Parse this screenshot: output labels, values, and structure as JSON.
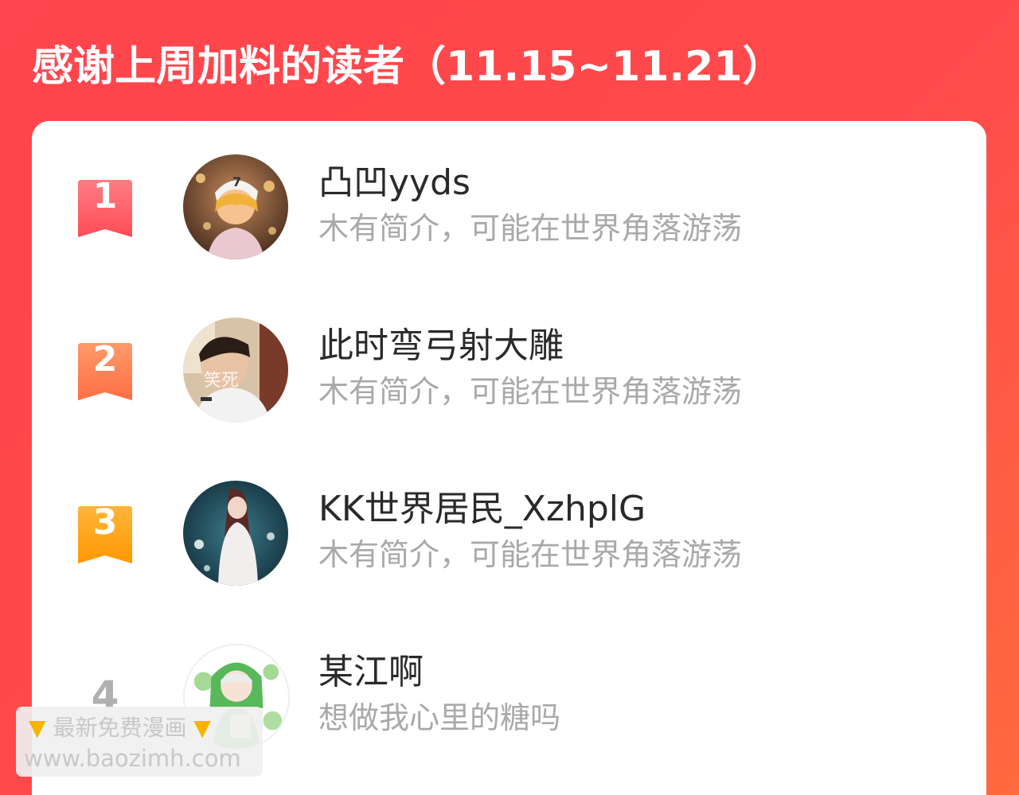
{
  "header": {
    "title": "感谢上周加料的读者（11.15~11.21）"
  },
  "colors": {
    "background_start": "#ff454d",
    "background_end": "#ff6a3e",
    "rank_1": "#ff5a62",
    "rank_2": "#ff7a4d",
    "rank_3": "#ffa21a",
    "name_text": "#2a2a2a",
    "bio_text": "#a9a9a9"
  },
  "readers": [
    {
      "rank": "1",
      "name": "凸凹yyds",
      "bio": "木有简介，可能在世界角落游荡",
      "avatar_icon": "anime-boy-cap-avatar"
    },
    {
      "rank": "2",
      "name": "此时弯弓射大雕",
      "bio": "木有简介，可能在世界角落游荡",
      "avatar_icon": "boy-photo-avatar",
      "avatar_text": "笑死"
    },
    {
      "rank": "3",
      "name": "KK世界居民_XzhplG",
      "bio": "木有简介，可能在世界角落游荡",
      "avatar_icon": "girl-forest-avatar"
    },
    {
      "rank": "4",
      "name": "某江啊",
      "bio": "想做我心里的糖吗",
      "avatar_icon": "green-hood-character-avatar"
    }
  ],
  "watermark": {
    "line1": "最新免费漫画",
    "line2": "www.baozimh.com",
    "icon": "pointing-down-hand-icon"
  }
}
